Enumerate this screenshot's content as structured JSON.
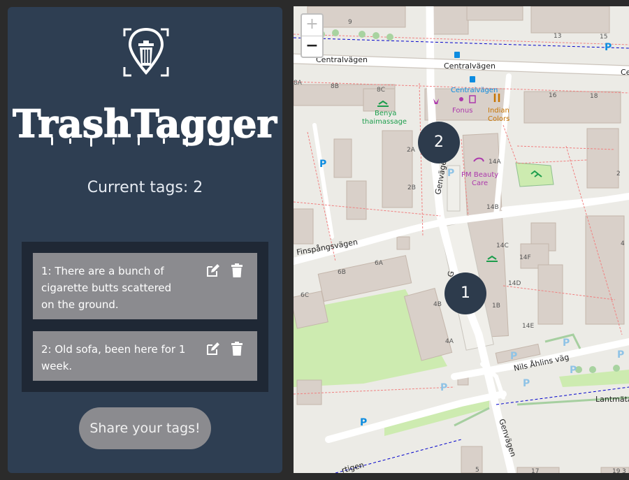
{
  "app": {
    "title": "TrashTagger"
  },
  "sidebar": {
    "current_tags": "Current tags: 2",
    "share_label": "Share your tags!"
  },
  "tags": [
    {
      "text": "1: There are a bunch of cigarette butts scattered on the ground."
    },
    {
      "text": "2: Old sofa, been here for 1 week."
    }
  ],
  "icons": {
    "logo": "trash-can-location-icon",
    "edit": "pencil-edit-icon",
    "delete": "trash-icon"
  },
  "map": {
    "zoom_in": "+",
    "zoom_out": "−",
    "markers": [
      "1",
      "2"
    ],
    "streets": {
      "centralvagen_1": "Centralvägen",
      "centralvagen_2": "Centralvägen",
      "centralvagen_3": "Ce",
      "centralvagen_stop": "Centralvägen",
      "finspangsvagen": "Finspångsvägen",
      "genvagen_1": "Genvägen",
      "genvagen_2": "G",
      "genvagen_3": "Genvägen",
      "nils_ahlins_vag": "Nils Åhlins väg",
      "lantmata": "Lantmäta",
      "bottom_left": "rtigen"
    },
    "pois": {
      "benya_1": "Benya",
      "benya_2": "thaimassage",
      "fonus": "Fonus",
      "indian_1": "Indian",
      "indian_2": "Colors",
      "pm_1": "PM Beauty",
      "pm_2": "Care"
    },
    "house_numbers": [
      "9",
      "13",
      "15",
      "8A",
      "8B",
      "8C",
      "16",
      "18",
      "2A",
      "2B",
      "14A",
      "2",
      "14B",
      "6A",
      "6B",
      "6C",
      "14C",
      "14F",
      "4",
      "4B",
      "14D",
      "1B",
      "14E",
      "4A",
      "5",
      "17",
      "19",
      "3"
    ]
  },
  "colors": {
    "sidebar_bg": "#2e3e52",
    "panel_bg": "#1f2835",
    "card_bg": "#8b8b8f",
    "marker_bg": "#2d3b4c",
    "parking": "#0d8ce0",
    "shop": "#ac39ac",
    "food": "#c77400",
    "leisure": "#1c9d4c"
  }
}
